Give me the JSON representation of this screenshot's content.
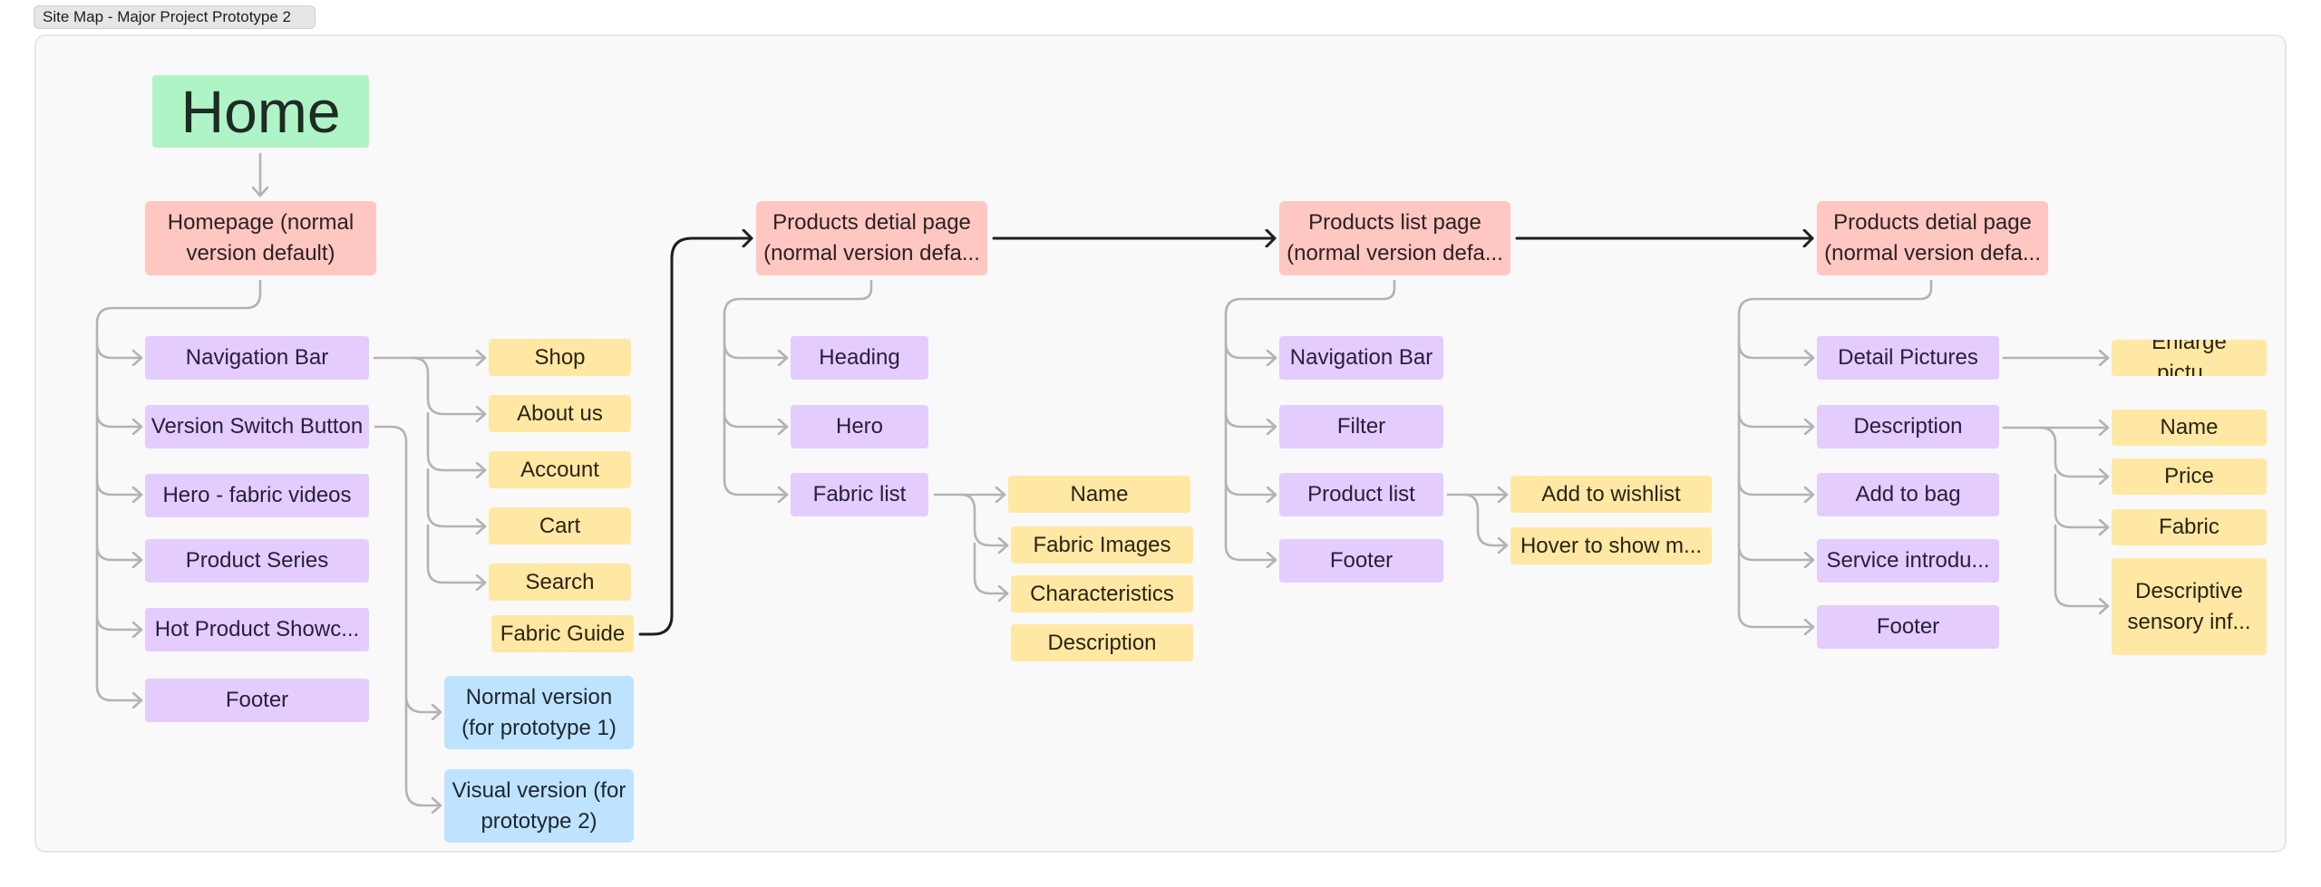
{
  "frame": {
    "title": "Site Map - Major Project Prototype 2"
  },
  "colors": {
    "root": "#aff4c6",
    "page": "#ffc7c2",
    "section": "#e4ccff",
    "feature": "#ffe8a3",
    "version": "#bde3ff",
    "connector": "#b3b3b3",
    "flow_connector": "#1e1e1e"
  },
  "root": {
    "label": "Home"
  },
  "homepage": {
    "label": "Homepage (normal version default)",
    "sections": [
      {
        "label": "Navigation Bar"
      },
      {
        "label": "Version Switch Button"
      },
      {
        "label": "Hero - fabric videos"
      },
      {
        "label": "Product Series"
      },
      {
        "label": "Hot Product Showc..."
      },
      {
        "label": "Footer"
      }
    ],
    "nav_items": [
      {
        "label": "Shop"
      },
      {
        "label": "About us"
      },
      {
        "label": "Account"
      },
      {
        "label": "Cart"
      },
      {
        "label": "Search"
      },
      {
        "label": "Fabric Guide"
      }
    ],
    "versions": [
      {
        "label": "Normal version (for prototype 1)"
      },
      {
        "label": "Visual version (for prototype 2)"
      }
    ]
  },
  "product_detail_1": {
    "label": "Products detial page (normal version defa...",
    "sections": [
      {
        "label": "Heading"
      },
      {
        "label": "Hero"
      },
      {
        "label": "Fabric list"
      }
    ],
    "fabric_items": [
      {
        "label": "Name"
      },
      {
        "label": "Fabric Images"
      },
      {
        "label": "Characteristics"
      },
      {
        "label": "Description"
      }
    ]
  },
  "product_list": {
    "label": "Products list page (normal version defa...",
    "sections": [
      {
        "label": "Navigation Bar"
      },
      {
        "label": "Filter"
      },
      {
        "label": "Product list"
      },
      {
        "label": "Footer"
      }
    ],
    "product_items": [
      {
        "label": "Add to wishlist"
      },
      {
        "label": "Hover to show m..."
      }
    ]
  },
  "product_detail_2": {
    "label": "Products detial page (normal version defa...",
    "sections": [
      {
        "label": "Detail Pictures"
      },
      {
        "label": "Description"
      },
      {
        "label": "Add to bag"
      },
      {
        "label": "Service introdu..."
      },
      {
        "label": "Footer"
      }
    ],
    "picture_items": [
      {
        "label": "Enlarge pictu..."
      }
    ],
    "description_items": [
      {
        "label": "Name"
      },
      {
        "label": "Price"
      },
      {
        "label": "Fabric"
      },
      {
        "label": "Descriptive sensory inf..."
      }
    ]
  }
}
